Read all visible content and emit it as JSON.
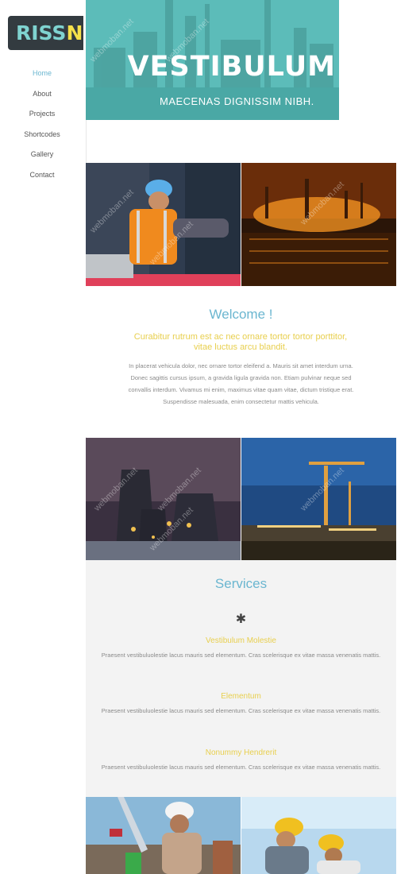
{
  "logo": {
    "part1": "RISS",
    "part2": "NE"
  },
  "nav": [
    {
      "label": "Home",
      "active": true
    },
    {
      "label": "About"
    },
    {
      "label": "Projects"
    },
    {
      "label": "Shortcodes"
    },
    {
      "label": "Gallery"
    },
    {
      "label": "Contact"
    }
  ],
  "hero": {
    "title": "VESTIBULUM",
    "subtitle": "MAECENAS DIGNISSIM NIBH."
  },
  "welcome": {
    "title": "Welcome !",
    "subtitle": "Curabitur rutrum est ac nec ornare tortor tortor porttitor, vitae luctus arcu blandit.",
    "body": "In placerat vehicula dolor, nec ornare tortor eleifend a. Mauris sit amet interdum urna. Donec sagittis cursus ipsum, a gravida ligula gravida non. Etiam pulvinar neque sed convallis interdum. Vivamus mi enim, maximus vitae quam vitae, dictum tristique erat. Suspendisse malesuada, enim consectetur mattis vehicula."
  },
  "services": {
    "title": "Services",
    "icon": "asterisk-icon",
    "items": [
      {
        "heading": "Vestibulum Molestie",
        "text": "Praesent vestibuluolestie lacus mauris sed elementum. Cras scelerisque ex vitae massa venenatis mattis."
      },
      {
        "heading": "Elementum",
        "text": "Praesent vestibuluolestie lacus mauris sed elementum. Cras scelerisque ex vitae massa venenatis mattis."
      },
      {
        "heading": "Nonummy Hendrerit",
        "text": "Praesent vestibuluolestie lacus mauris sed elementum. Cras scelerisque ex vitae massa venenatis mattis."
      }
    ]
  },
  "watermark": "webmoban.net",
  "colors": {
    "accent": "#6bb6d0",
    "yellow": "#e8cf4e",
    "teal": "#7fd3d0",
    "logo_bg": "#333b40"
  }
}
